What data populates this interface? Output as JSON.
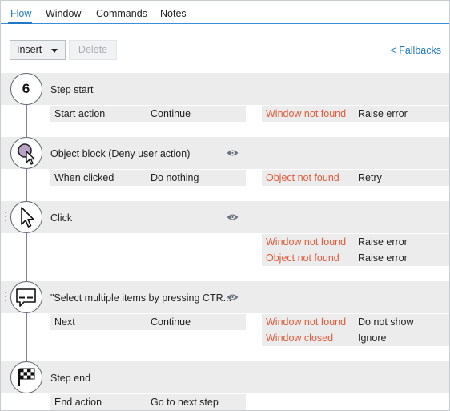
{
  "tabs": [
    {
      "label": "Flow",
      "active": true
    },
    {
      "label": "Window",
      "active": false
    },
    {
      "label": "Commands",
      "active": false
    },
    {
      "label": "Notes",
      "active": false
    }
  ],
  "toolbar": {
    "insert_label": "Insert",
    "delete_label": "Delete",
    "fallbacks_label": "< Fallbacks"
  },
  "colors": {
    "accent": "#1f79c7",
    "fallback_condition": "#e05a3b",
    "row_background": "#ececec"
  },
  "steps": [
    {
      "icon": "step-number",
      "number": "6",
      "title": "Step start",
      "left": [
        {
          "key": "Start action",
          "value": "Continue"
        }
      ],
      "right": [
        {
          "condition": "Window not found",
          "action": "Raise error"
        }
      ]
    },
    {
      "icon": "object-block-icon",
      "title": "Object block (Deny user action)",
      "left": [
        {
          "key": "When clicked",
          "value": "Do nothing"
        }
      ],
      "right": [
        {
          "condition": "Object not found",
          "action": "Retry"
        }
      ]
    },
    {
      "icon": "cursor-icon",
      "title": "Click",
      "left": [],
      "right": [
        {
          "condition": "Window not found",
          "action": "Raise error"
        },
        {
          "condition": "Object not found",
          "action": "Raise error"
        }
      ]
    },
    {
      "icon": "message-icon",
      "title": "\"Select multiple items by pressing CTR...",
      "left": [
        {
          "key": "Next",
          "value": "Continue"
        }
      ],
      "right": [
        {
          "condition": "Window not found",
          "action": "Do not show"
        },
        {
          "condition": "Window closed",
          "action": "Ignore"
        }
      ]
    },
    {
      "icon": "checkered-flag-icon",
      "title": "Step end",
      "left": [
        {
          "key": "End action",
          "value": "Go to next step"
        }
      ],
      "right": []
    }
  ]
}
